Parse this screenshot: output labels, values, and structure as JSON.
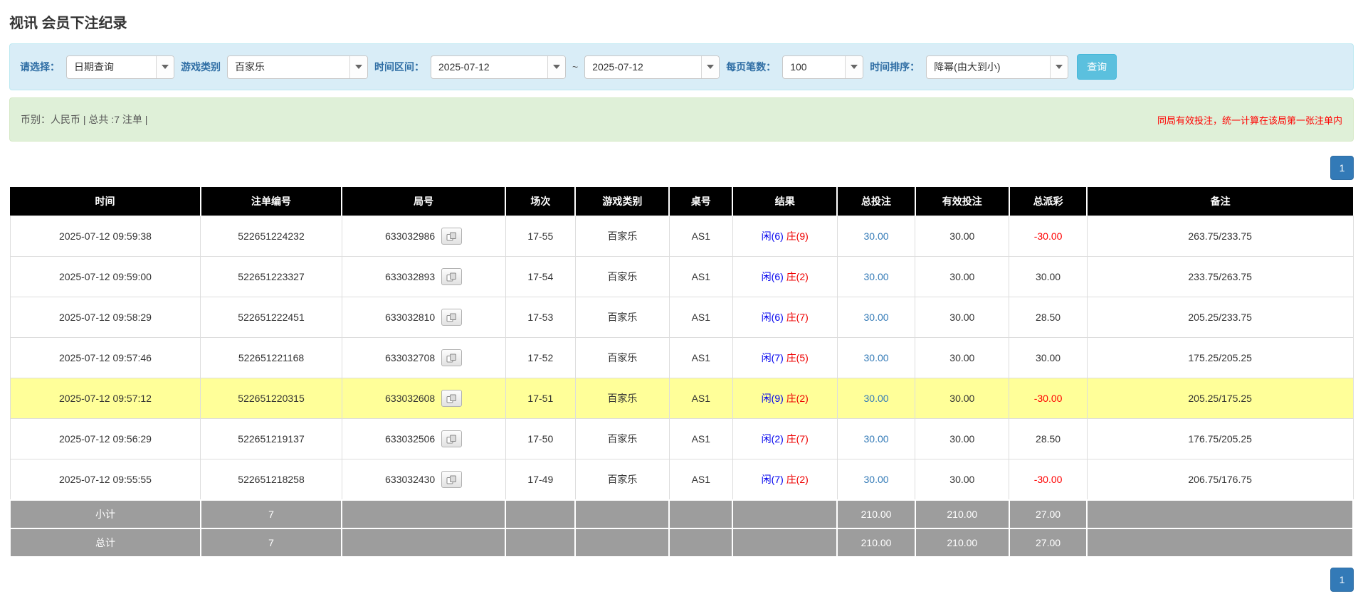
{
  "colors": {
    "accent_blue": "#337ab7",
    "info_button_bg": "#5bc0de",
    "filter_bar_bg": "#d9edf7",
    "summary_bar_bg": "#dff0d8",
    "table_header_bg": "#000000",
    "footer_row_bg": "#9d9d9d",
    "highlight_row_bg": "#ffff99",
    "player_blue": "#0000ee",
    "banker_red": "#ee0000",
    "negative_red": "#ff0000",
    "note_red": "#ff0000"
  },
  "page": {
    "title": "视讯 会员下注纪录"
  },
  "filters": {
    "query_type": {
      "label": "请选择：",
      "value": "日期查询"
    },
    "game_type": {
      "label": "游戏类别",
      "value": "百家乐"
    },
    "date_range": {
      "label": "时间区间：",
      "from": "2025-07-12",
      "separator": "~",
      "to": "2025-07-12"
    },
    "page_size": {
      "label": "每页笔数：",
      "value": "100"
    },
    "time_sort": {
      "label": "时间排序：",
      "value": "降幂(由大到小)"
    },
    "search_button": "查询"
  },
  "summary": {
    "left": "币别：人民币 | 总共 :7 注单 |",
    "note": "同局有效投注，统一计算在该局第一张注单内"
  },
  "pagination": {
    "page": "1"
  },
  "table": {
    "headers": [
      "时间",
      "注单编号",
      "局号",
      "场次",
      "游戏类别",
      "桌号",
      "结果",
      "总投注",
      "有效投注",
      "总派彩",
      "备注"
    ],
    "rows": [
      {
        "time": "2025-07-12 09:59:38",
        "bet_id": "522651224232",
        "round": "633032986",
        "session": "17-55",
        "game": "百家乐",
        "table_no": "AS1",
        "result_player": "闲(6)",
        "result_banker": "庄(9)",
        "total_bet": "30.00",
        "valid_bet": "30.00",
        "payout": "-30.00",
        "payout_negative": true,
        "remark": "263.75/233.75",
        "highlight": false
      },
      {
        "time": "2025-07-12 09:59:00",
        "bet_id": "522651223327",
        "round": "633032893",
        "session": "17-54",
        "game": "百家乐",
        "table_no": "AS1",
        "result_player": "闲(6)",
        "result_banker": "庄(2)",
        "total_bet": "30.00",
        "valid_bet": "30.00",
        "payout": "30.00",
        "payout_negative": false,
        "remark": "233.75/263.75",
        "highlight": false
      },
      {
        "time": "2025-07-12 09:58:29",
        "bet_id": "522651222451",
        "round": "633032810",
        "session": "17-53",
        "game": "百家乐",
        "table_no": "AS1",
        "result_player": "闲(6)",
        "result_banker": "庄(7)",
        "total_bet": "30.00",
        "valid_bet": "30.00",
        "payout": "28.50",
        "payout_negative": false,
        "remark": "205.25/233.75",
        "highlight": false
      },
      {
        "time": "2025-07-12 09:57:46",
        "bet_id": "522651221168",
        "round": "633032708",
        "session": "17-52",
        "game": "百家乐",
        "table_no": "AS1",
        "result_player": "闲(7)",
        "result_banker": "庄(5)",
        "total_bet": "30.00",
        "valid_bet": "30.00",
        "payout": "30.00",
        "payout_negative": false,
        "remark": "175.25/205.25",
        "highlight": false
      },
      {
        "time": "2025-07-12 09:57:12",
        "bet_id": "522651220315",
        "round": "633032608",
        "session": "17-51",
        "game": "百家乐",
        "table_no": "AS1",
        "result_player": "闲(9)",
        "result_banker": "庄(2)",
        "total_bet": "30.00",
        "valid_bet": "30.00",
        "payout": "-30.00",
        "payout_negative": true,
        "remark": "205.25/175.25",
        "highlight": true
      },
      {
        "time": "2025-07-12 09:56:29",
        "bet_id": "522651219137",
        "round": "633032506",
        "session": "17-50",
        "game": "百家乐",
        "table_no": "AS1",
        "result_player": "闲(2)",
        "result_banker": "庄(7)",
        "total_bet": "30.00",
        "valid_bet": "30.00",
        "payout": "28.50",
        "payout_negative": false,
        "remark": "176.75/205.25",
        "highlight": false
      },
      {
        "time": "2025-07-12 09:55:55",
        "bet_id": "522651218258",
        "round": "633032430",
        "session": "17-49",
        "game": "百家乐",
        "table_no": "AS1",
        "result_player": "闲(7)",
        "result_banker": "庄(2)",
        "total_bet": "30.00",
        "valid_bet": "30.00",
        "payout": "-30.00",
        "payout_negative": true,
        "remark": "206.75/176.75",
        "highlight": false
      }
    ],
    "subtotal": {
      "label": "小计",
      "count": "7",
      "total_bet": "210.00",
      "valid_bet": "210.00",
      "payout": "27.00"
    },
    "total": {
      "label": "总计",
      "count": "7",
      "total_bet": "210.00",
      "valid_bet": "210.00",
      "payout": "27.00"
    }
  }
}
